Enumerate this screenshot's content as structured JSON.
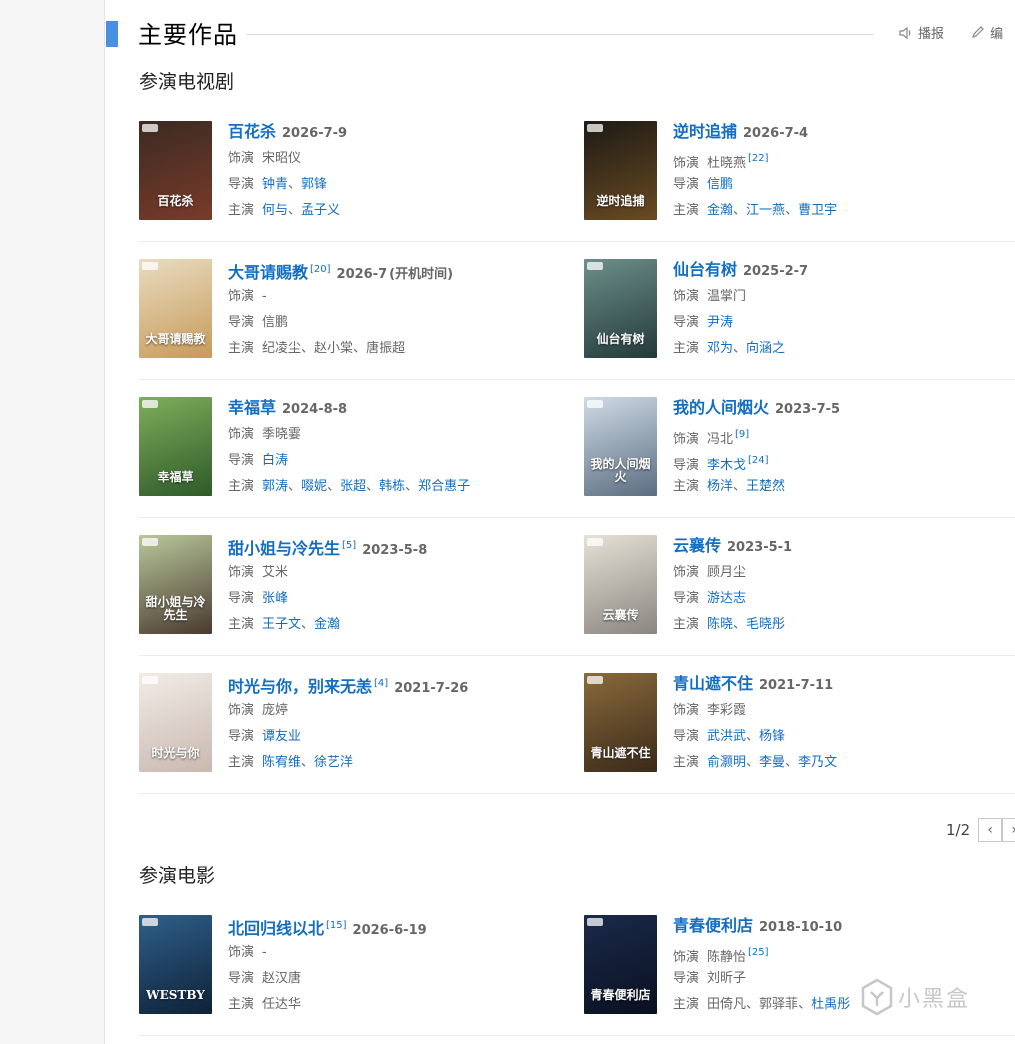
{
  "section": {
    "title": "主要作品",
    "tools": {
      "report": "播报",
      "edit": "编"
    }
  },
  "tv": {
    "subtitle": "参演电视剧",
    "role_label": "饰演",
    "director_label": "导演",
    "cast_label": "主演",
    "rows": [
      [
        {
          "name": "百花杀",
          "date": "2026-7-9",
          "ref": "",
          "extra": "",
          "role": "宋昭仪",
          "role_ref": "",
          "directors": [
            {
              "t": "钟青",
              "link": true
            },
            {
              "t": "郭锋",
              "link": true
            }
          ],
          "director_ref": "",
          "cast": [
            {
              "t": "何与",
              "link": true
            },
            {
              "t": "孟子义",
              "link": true
            }
          ],
          "poster_colors": [
            "#3a2a22",
            "#7a3b2a"
          ],
          "poster_text": "百花杀"
        },
        {
          "name": "逆时追捕",
          "date": "2026-7-4",
          "ref": "",
          "extra": "",
          "role": "杜晓燕",
          "role_ref": "[22]",
          "directors": [
            {
              "t": "信鹏",
              "link": true
            }
          ],
          "director_ref": "",
          "cast": [
            {
              "t": "金瀚",
              "link": true
            },
            {
              "t": "江一燕",
              "link": true
            },
            {
              "t": "曹卫宇",
              "link": true
            }
          ],
          "poster_colors": [
            "#1d1a16",
            "#6a4b22"
          ],
          "poster_text": "逆时追捕"
        }
      ],
      [
        {
          "name": "大哥请赐教",
          "date": "2026-7",
          "ref": "[20]",
          "extra": "(开机时间)",
          "role": "-",
          "role_ref": "",
          "directors": [
            {
              "t": "信鹏",
              "link": false
            }
          ],
          "director_ref": "",
          "cast": [
            {
              "t": "纪凌尘",
              "link": false
            },
            {
              "t": "赵小棠",
              "link": false
            },
            {
              "t": "唐振超",
              "link": false
            }
          ],
          "poster_colors": [
            "#e8dcc0",
            "#c79a5a"
          ],
          "poster_text": "大哥请赐教"
        },
        {
          "name": "仙台有树",
          "date": "2025-2-7",
          "ref": "",
          "extra": "",
          "role": "温掌门",
          "role_ref": "",
          "directors": [
            {
              "t": "尹涛",
              "link": true
            }
          ],
          "director_ref": "",
          "cast": [
            {
              "t": "邓为",
              "link": true
            },
            {
              "t": "向涵之",
              "link": true
            }
          ],
          "poster_colors": [
            "#6d8f8a",
            "#233a3a"
          ],
          "poster_text": "仙台有树"
        }
      ],
      [
        {
          "name": "幸福草",
          "date": "2024-8-8",
          "ref": "",
          "extra": "",
          "role": "季晓霎",
          "role_ref": "",
          "directors": [
            {
              "t": "白涛",
              "link": true
            }
          ],
          "director_ref": "",
          "cast": [
            {
              "t": "郭涛",
              "link": true
            },
            {
              "t": "啜妮",
              "link": true
            },
            {
              "t": "张超",
              "link": true
            },
            {
              "t": "韩栋",
              "link": true
            },
            {
              "t": "郑合惠子",
              "link": true
            }
          ],
          "poster_colors": [
            "#7fae5a",
            "#2e5a2a"
          ],
          "poster_text": "幸福草"
        },
        {
          "name": "我的人间烟火",
          "date": "2023-7-5",
          "ref": "",
          "extra": "",
          "role": "冯北",
          "role_ref": "[9]",
          "directors": [
            {
              "t": "李木戈",
              "link": true
            }
          ],
          "director_ref": "[24]",
          "cast": [
            {
              "t": "杨洋",
              "link": true
            },
            {
              "t": "王楚然",
              "link": true
            }
          ],
          "poster_colors": [
            "#cfdbe6",
            "#5a6d80"
          ],
          "poster_text": "我的人间烟火"
        }
      ],
      [
        {
          "name": "甜小姐与冷先生",
          "date": "2023-5-8",
          "ref": "[5]",
          "extra": "",
          "role": "艾米",
          "role_ref": "",
          "directors": [
            {
              "t": "张峰",
              "link": true
            }
          ],
          "director_ref": "",
          "cast": [
            {
              "t": "王子文",
              "link": true
            },
            {
              "t": "金瀚",
              "link": true
            }
          ],
          "poster_colors": [
            "#b8c89a",
            "#4a3a30"
          ],
          "poster_text": "甜小姐与冷先生"
        },
        {
          "name": "云襄传",
          "date": "2023-5-1",
          "ref": "",
          "extra": "",
          "role": "顾月尘",
          "role_ref": "",
          "directors": [
            {
              "t": "游达志",
              "link": true
            }
          ],
          "director_ref": "",
          "cast": [
            {
              "t": "陈晓",
              "link": true
            },
            {
              "t": "毛晓彤",
              "link": true
            }
          ],
          "poster_colors": [
            "#e6e1d6",
            "#8a8680"
          ],
          "poster_text": "云襄传"
        }
      ],
      [
        {
          "name": "时光与你，别来无恙",
          "date": "2021-7-26",
          "ref": "[4]",
          "extra": "",
          "role": "庞婷",
          "role_ref": "",
          "directors": [
            {
              "t": "谭友业",
              "link": true
            }
          ],
          "director_ref": "",
          "cast": [
            {
              "t": "陈宥维",
              "link": true
            },
            {
              "t": "徐艺洋",
              "link": true
            }
          ],
          "poster_colors": [
            "#f2ece6",
            "#c8b8b0"
          ],
          "poster_text": "时光与你"
        },
        {
          "name": "青山遮不住",
          "date": "2021-7-11",
          "ref": "",
          "extra": "",
          "role": "李彩霞",
          "role_ref": "",
          "directors": [
            {
              "t": "武洪武",
              "link": true
            },
            {
              "t": "杨锋",
              "link": true
            }
          ],
          "director_ref": "",
          "cast": [
            {
              "t": "俞灏明",
              "link": true
            },
            {
              "t": "李曼",
              "link": true
            },
            {
              "t": "李乃文",
              "link": true
            }
          ],
          "poster_colors": [
            "#8a6a3a",
            "#3a2a1a"
          ],
          "poster_text": "青山遮不住"
        }
      ]
    ],
    "pager": {
      "text": "1/2",
      "prev": "‹",
      "next": "›"
    }
  },
  "movie": {
    "subtitle": "参演电影",
    "rows": [
      [
        {
          "name": "北回归线以北",
          "date": "2026-6-19",
          "ref": "[15]",
          "extra": "",
          "role": "-",
          "role_ref": "",
          "directors": [
            {
              "t": "赵汉唐",
              "link": false
            }
          ],
          "director_ref": "",
          "cast": [
            {
              "t": "任达华",
              "link": false
            }
          ],
          "poster_colors": [
            "#2f5f8a",
            "#0e2238"
          ],
          "poster_text": "WESTBY"
        },
        {
          "name": "青春便利店",
          "date": "2018-10-10",
          "ref": "",
          "extra": "",
          "role": "陈静怡",
          "role_ref": "[25]",
          "directors": [
            {
              "t": "刘昕子",
              "link": false
            }
          ],
          "director_ref": "",
          "cast": [
            {
              "t": "田倚凡",
              "link": false
            },
            {
              "t": "郭驿菲",
              "link": false
            },
            {
              "t": "杜禹彤",
              "link": true
            }
          ],
          "poster_colors": [
            "#1a2a4a",
            "#0a1020"
          ],
          "poster_text": "青春便利店"
        }
      ]
    ]
  },
  "watermark": {
    "text": "小黑盒"
  },
  "colors": {
    "accent": "#4a90e2",
    "link": "#136ec2"
  }
}
